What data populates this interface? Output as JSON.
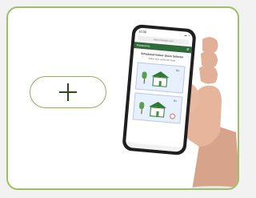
{
  "add_button": {
    "icon": "plus-icon"
  },
  "phone": {
    "status_time": "10:30",
    "status_icons": "▪▪ ◔",
    "url": "www.example.com",
    "header_title": "Panasonic",
    "header_actions": "☰",
    "content_title": "Scheduled Indoor Quick Selector",
    "content_subtitle": "Select your preferred mode",
    "panel1_label": "Yes",
    "panel2_label": "No"
  },
  "colors": {
    "card_border": "#9cc063",
    "button_border": "#8fb04f",
    "plus": "#2e4a1d",
    "phone_header": "#2f6b3a"
  }
}
